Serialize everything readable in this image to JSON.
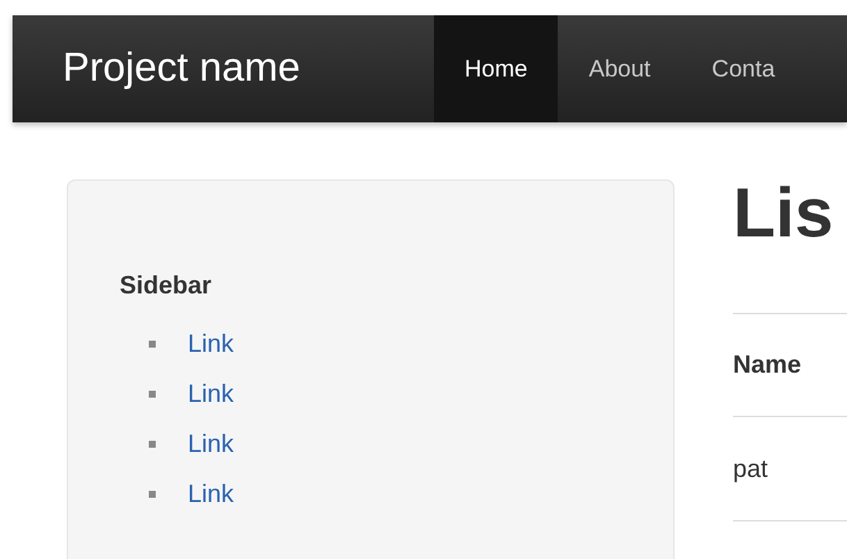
{
  "navbar": {
    "brand": "Project name",
    "tabs": [
      {
        "label": "Home",
        "selected": true
      },
      {
        "label": "About",
        "selected": false
      },
      {
        "label": "Conta",
        "selected": false
      }
    ]
  },
  "sidebar": {
    "heading": "Sidebar",
    "links": [
      "Link",
      "Link",
      "Link",
      "Link"
    ]
  },
  "main": {
    "heading": "Lis",
    "table": {
      "columns": [
        "Name"
      ],
      "rows": [
        [
          "pat"
        ]
      ]
    }
  }
}
